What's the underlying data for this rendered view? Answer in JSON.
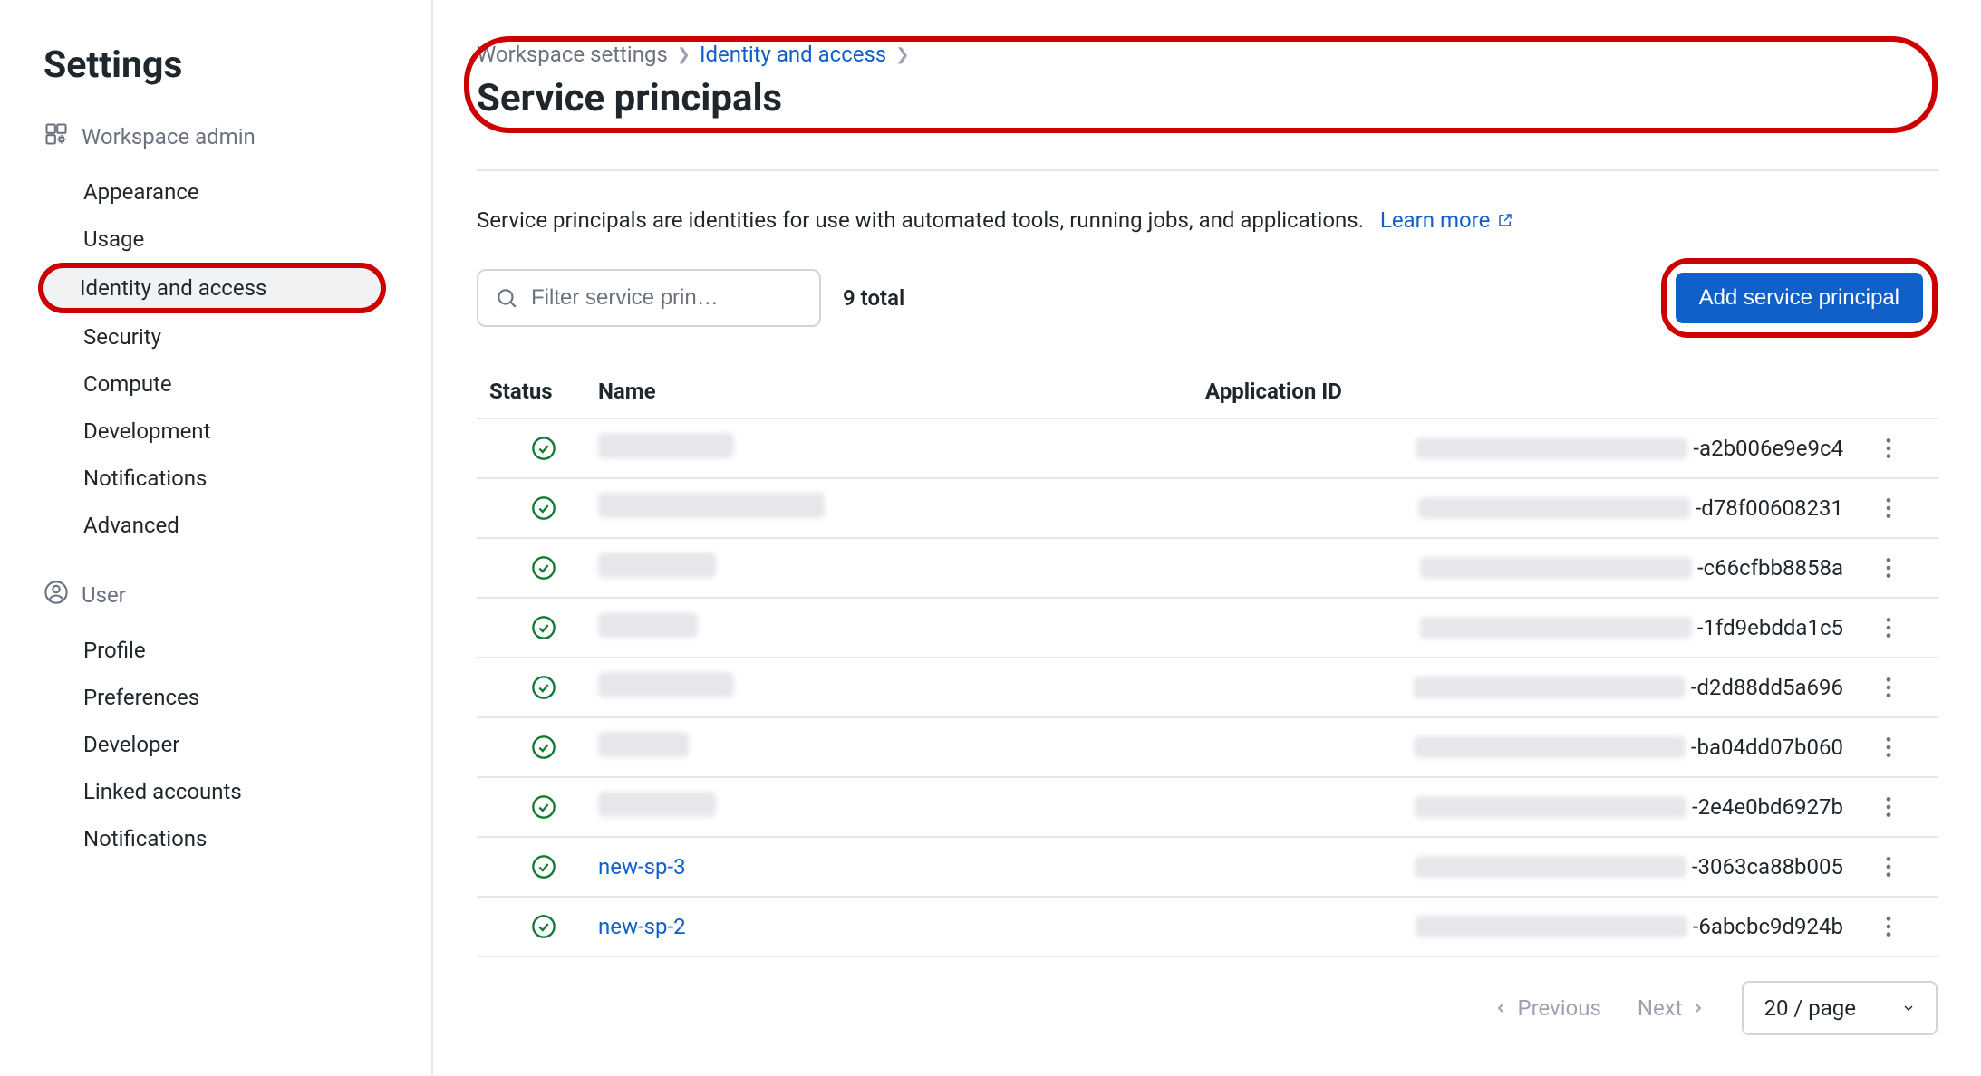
{
  "sidebar": {
    "title": "Settings",
    "sections": [
      {
        "label": "Workspace admin",
        "icon": "workspace-admin-icon",
        "items": [
          {
            "label": "Appearance",
            "active": false
          },
          {
            "label": "Usage",
            "active": false
          },
          {
            "label": "Identity and access",
            "active": true
          },
          {
            "label": "Security",
            "active": false
          },
          {
            "label": "Compute",
            "active": false
          },
          {
            "label": "Development",
            "active": false
          },
          {
            "label": "Notifications",
            "active": false
          },
          {
            "label": "Advanced",
            "active": false
          }
        ]
      },
      {
        "label": "User",
        "icon": "user-icon",
        "items": [
          {
            "label": "Profile",
            "active": false
          },
          {
            "label": "Preferences",
            "active": false
          },
          {
            "label": "Developer",
            "active": false
          },
          {
            "label": "Linked accounts",
            "active": false
          },
          {
            "label": "Notifications",
            "active": false
          }
        ]
      }
    ]
  },
  "breadcrumbs": {
    "root": "Workspace settings",
    "mid": "Identity and access"
  },
  "page_title": "Service principals",
  "description_text": "Service principals are identities for use with automated tools, running jobs, and applications.",
  "learn_more_label": "Learn more",
  "filter_placeholder": "Filter service prin…",
  "total_label": "9 total",
  "add_button_label": "Add service principal",
  "columns": {
    "status": "Status",
    "name": "Name",
    "appid": "Application ID"
  },
  "rows": [
    {
      "name": "",
      "name_redacted": true,
      "name_blur_width": 150,
      "appid_suffix": "-a2b006e9e9c4",
      "appid_prefix_redacted": true
    },
    {
      "name": "",
      "name_redacted": true,
      "name_blur_width": 250,
      "appid_suffix": "-d78f00608231",
      "appid_prefix_redacted": true
    },
    {
      "name": "",
      "name_redacted": true,
      "name_blur_width": 130,
      "appid_suffix": "-c66cfbb8858a",
      "appid_prefix_redacted": true
    },
    {
      "name": "",
      "name_redacted": true,
      "name_blur_width": 110,
      "appid_suffix": "-1fd9ebdda1c5",
      "appid_prefix_redacted": true
    },
    {
      "name": "",
      "name_redacted": true,
      "name_blur_width": 150,
      "appid_suffix": "-d2d88dd5a696",
      "appid_prefix_redacted": true
    },
    {
      "name": "",
      "name_redacted": true,
      "name_blur_width": 100,
      "appid_suffix": "-ba04dd07b060",
      "appid_prefix_redacted": true
    },
    {
      "name": "",
      "name_redacted": true,
      "name_blur_width": 130,
      "appid_suffix": "-2e4e0bd6927b",
      "appid_prefix_redacted": true
    },
    {
      "name": "new-sp-3",
      "name_redacted": false,
      "name_blur_width": 0,
      "appid_suffix": "-3063ca88b005",
      "appid_prefix_redacted": true
    },
    {
      "name": "new-sp-2",
      "name_redacted": false,
      "name_blur_width": 0,
      "appid_suffix": "-6abcbc9d924b",
      "appid_prefix_redacted": true
    }
  ],
  "pagination": {
    "prev_label": "Previous",
    "next_label": "Next",
    "page_size_label": "20 / page"
  }
}
